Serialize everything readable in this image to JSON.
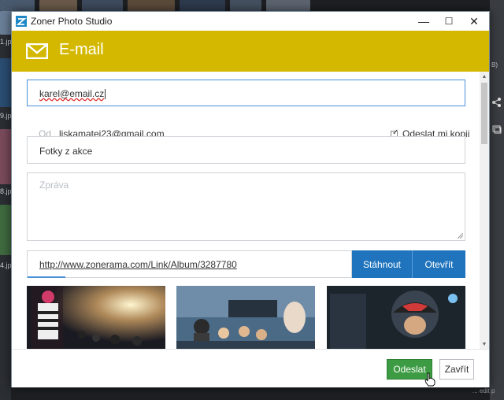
{
  "window": {
    "title": "Zoner Photo Studio",
    "minimize_glyph": "—",
    "maximize_glyph": "☐",
    "close_glyph": "✕"
  },
  "header": {
    "title": "E-mail",
    "icon": "envelope-icon",
    "color": "#d4b800"
  },
  "form": {
    "to_value": "karel@email.cz",
    "from_label": "Od",
    "from_value": "liskamatej23@gmail.com",
    "send_copy_label": "Odeslat mi kopii",
    "send_copy_checked": true,
    "subject_value": "Fotky z akce",
    "message_placeholder": "Zpráva"
  },
  "link": {
    "url": "http://www.zonerama.com/Link/Album/3287780",
    "download_label": "Stáhnout",
    "open_label": "Otevřít"
  },
  "footer": {
    "send_label": "Odeslat",
    "close_label": "Zavřít"
  },
  "background": {
    "file_labels": [
      "1.jp",
      "9.jp",
      "8.jp",
      "4.jp"
    ],
    "right_labels": [
      "B)"
    ],
    "bottom_text": "... edit p"
  },
  "colors": {
    "accent_blue": "#1f74bd",
    "send_green": "#3d9b43",
    "header_yellow": "#d4b800"
  }
}
